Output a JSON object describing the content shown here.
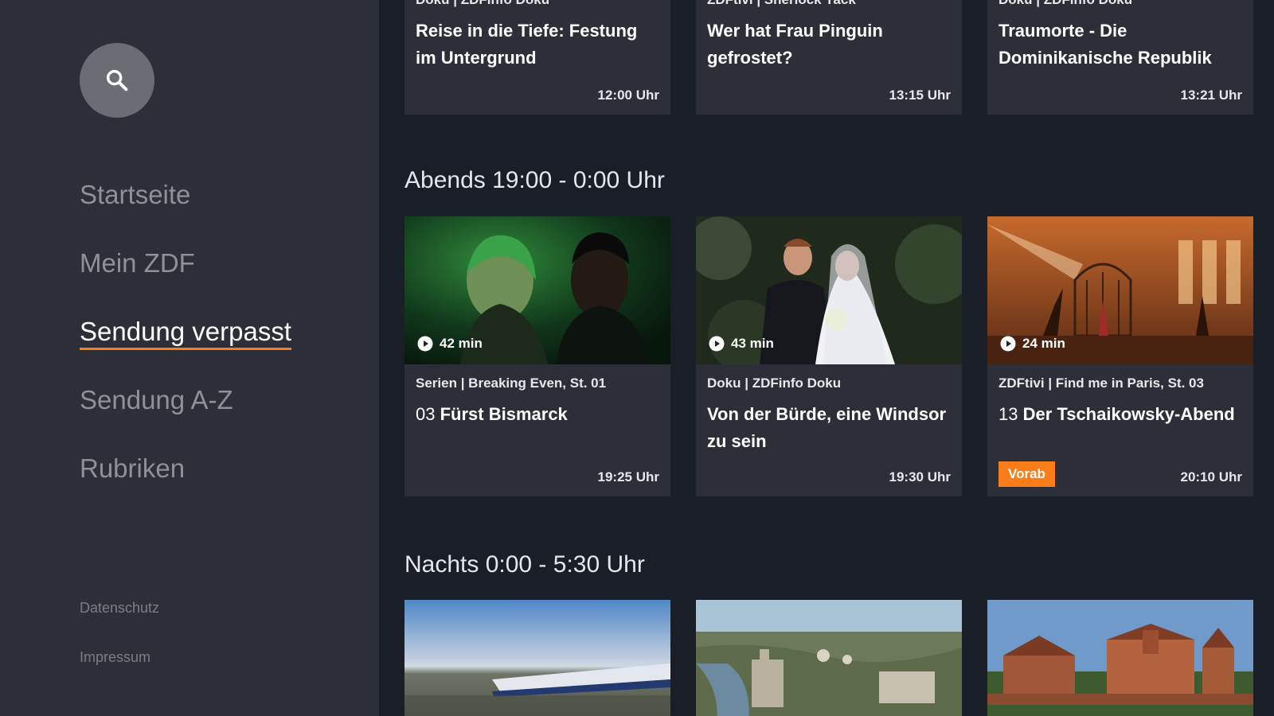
{
  "sidebar": {
    "search_icon": "search-icon",
    "nav": [
      {
        "label": "Startseite",
        "active": false
      },
      {
        "label": "Mein ZDF",
        "active": false
      },
      {
        "label": "Sendung verpasst",
        "active": true
      },
      {
        "label": "Sendung A-Z",
        "active": false
      },
      {
        "label": "Rubriken",
        "active": false
      }
    ],
    "footer": [
      "Datenschutz",
      "Impressum"
    ]
  },
  "top_row": [
    {
      "meta": "Doku | ZDFinfo Doku",
      "title": "Reise in die Tiefe: Festung im Untergrund",
      "time": "12:00 Uhr"
    },
    {
      "meta": "ZDFtivi | Sherlock Yack",
      "title": "Wer hat Frau Pinguin gefrostet?",
      "time": "13:15 Uhr"
    },
    {
      "meta": "Doku | ZDFinfo Doku",
      "title": "Traumorte - Die Dominikanische Republik",
      "time": "13:21 Uhr"
    }
  ],
  "sections": {
    "evening_title": "Abends 19:00 - 0:00 Uhr",
    "night_title": "Nachts 0:00 - 5:30 Uhr"
  },
  "evening_row": [
    {
      "duration": "42 min",
      "meta": "Serien | Breaking Even, St. 01",
      "episode": "03",
      "title": "Fürst Bismarck",
      "time": "19:25 Uhr"
    },
    {
      "duration": "43 min",
      "meta": "Doku | ZDFinfo Doku",
      "episode": "",
      "title": "Von der Bürde, eine Windsor zu sein",
      "time": "19:30 Uhr"
    },
    {
      "duration": "24 min",
      "meta": "ZDFtivi | Find me in Paris, St. 03",
      "episode": "13",
      "title": "Der Tschaikowsky-Abend",
      "time": "20:10 Uhr",
      "badge": "Vorab"
    }
  ],
  "colors": {
    "accent": "#fa7d19",
    "sidebar_bg": "#2c2f38",
    "main_bg": "#1a1e26",
    "card_bg": "#2c2f38"
  }
}
